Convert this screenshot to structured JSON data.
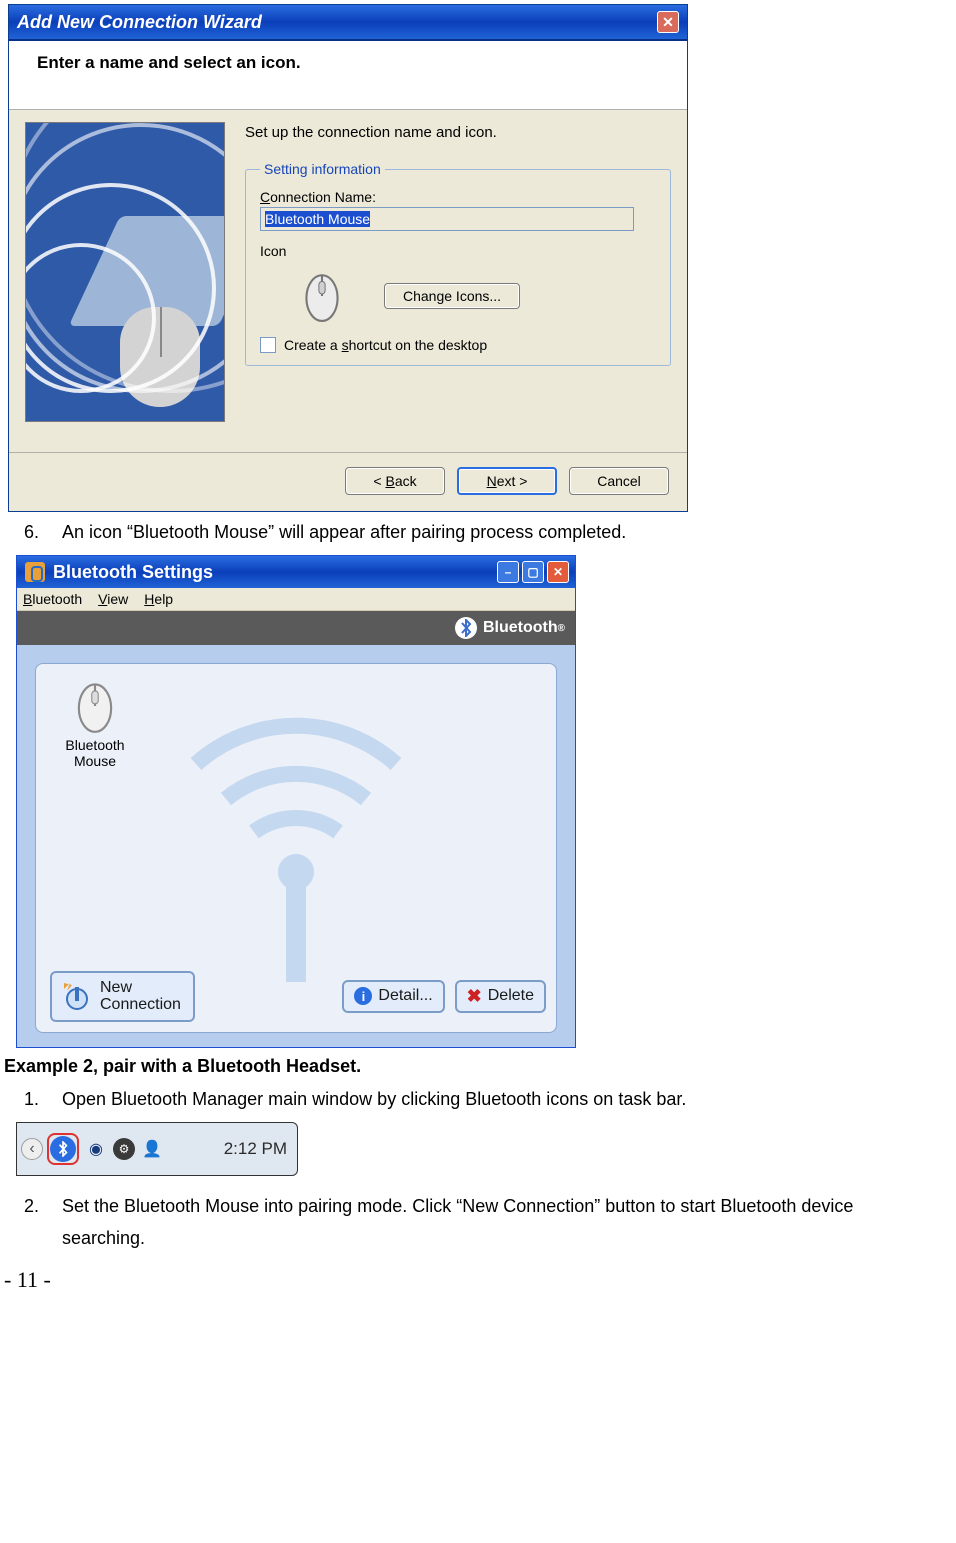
{
  "wizard": {
    "title": "Add New Connection Wizard",
    "header": "Enter a name and select an icon.",
    "hint": "Set up the connection name and icon.",
    "legend": "Setting information",
    "connNameLabel": "Connection Name:",
    "connNameValue": "Bluetooth Mouse",
    "iconLabel": "Icon",
    "changeIcons": "Change Icons...",
    "shortcut": "Create a shortcut on the desktop",
    "back": "< Back",
    "next": "Next >",
    "cancel": "Cancel"
  },
  "step6": {
    "no": "6.",
    "text": "An icon “Bluetooth Mouse” will appear after pairing process completed."
  },
  "bt": {
    "title": "Bluetooth Settings",
    "menu": {
      "bluetooth": "Bluetooth",
      "view": "View",
      "help": "Help"
    },
    "brand": "Bluetooth",
    "deviceLabel": "Bluetooth\nMouse",
    "newConnection": "New\nConnection",
    "detail": "Detail...",
    "delete": "Delete"
  },
  "example2": "Example 2, pair with a Bluetooth Headset.",
  "step1": {
    "no": "1.",
    "text": "Open Bluetooth Manager main window by clicking Bluetooth icons on task bar."
  },
  "tray": {
    "time": "2:12 PM"
  },
  "step2": {
    "no": "2.",
    "text": "Set the Bluetooth Mouse into pairing mode. Click “New Connection” button to start Bluetooth device searching."
  },
  "pageNumber": "- 11 -"
}
